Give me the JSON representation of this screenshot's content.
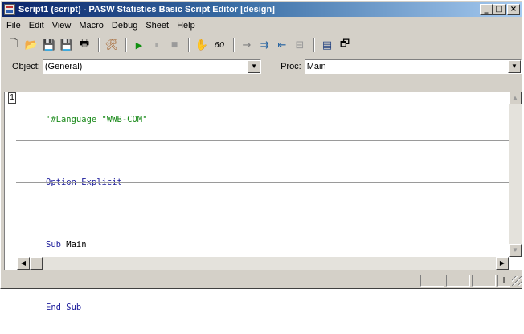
{
  "window": {
    "title": "Script1 (script) - PASW Statistics Basic Script Editor [design]",
    "buttons": {
      "minimize": "_",
      "maximize": "□",
      "close": "×"
    }
  },
  "menu": [
    "File",
    "Edit",
    "View",
    "Macro",
    "Debug",
    "Sheet",
    "Help"
  ],
  "toolbar": {
    "icons": [
      "new-icon",
      "open-icon",
      "save-icon",
      "save-all-icon",
      "print-icon",
      "dialog-icon",
      "run-icon",
      "pause-icon",
      "stop-icon",
      "hand-icon",
      "watch-icon",
      "step-into-icon",
      "step-over-icon",
      "step-out-icon",
      "toggle-breakpoint-icon",
      "properties-icon"
    ],
    "glyphs": {
      "new": "🗋",
      "open": "📂",
      "save": "💾",
      "save_all": "💾",
      "print": "🖶",
      "dialog": "🛠",
      "run": "▶",
      "pause": "⏸",
      "stop": "■",
      "hand": "✋",
      "watch": "60",
      "step_into": "→",
      "step_over": "⇉",
      "step_out": "⇤",
      "breakpoint": "⊟",
      "props": "▤",
      "browse": "🗗"
    }
  },
  "objects": {
    "object_label": "Object:",
    "object_value": "(General)",
    "proc_label": "Proc:",
    "proc_value": "Main"
  },
  "editor": {
    "line_indicator": "1",
    "lines": [
      {
        "text": "'#Language \"WWB-COM\"",
        "style": "comment"
      },
      {
        "text": "",
        "style": "plain"
      },
      {
        "text": "Option Explicit",
        "style": "keyword"
      },
      {
        "text": "",
        "style": "plain"
      },
      {
        "text": "Sub Main",
        "style": "sub"
      },
      {
        "text": "",
        "style": "plain"
      },
      {
        "text": "End Sub",
        "style": "keyword"
      }
    ],
    "code": {
      "l1": "'#Language \"WWB-COM\"",
      "l3": "Option Explicit",
      "l5_kw": "Sub",
      "l5_name": " Main",
      "l7": "End Sub"
    }
  },
  "statusbar": {
    "panels": [
      "",
      "",
      ""
    ]
  },
  "colors": {
    "title_start": "#0a246a",
    "title_end": "#a6caf0",
    "face": "#d4d0c8",
    "keyword": "#1a1a9a",
    "comment": "#1a8a1a"
  }
}
